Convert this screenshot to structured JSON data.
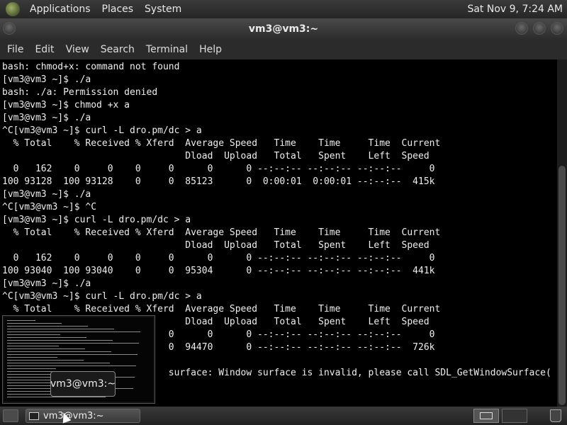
{
  "top_panel": {
    "menus": [
      "Applications",
      "Places",
      "System"
    ],
    "clock": "Sat Nov 9, 7:24 AM"
  },
  "window": {
    "title": "vm3@vm3:~",
    "menu": [
      "File",
      "Edit",
      "View",
      "Search",
      "Terminal",
      "Help"
    ]
  },
  "terminal": {
    "lines": [
      "bash: chmod+x: command not found",
      "[vm3@vm3 ~]$ ./a",
      "bash: ./a: Permission denied",
      "[vm3@vm3 ~]$ chmod +x a",
      "[vm3@vm3 ~]$ ./a",
      "^C[vm3@vm3 ~]$ curl -L dro.pm/dc > a",
      "  % Total    % Received % Xferd  Average Speed   Time    Time     Time  Current",
      "                                 Dload  Upload   Total   Spent    Left  Speed",
      "  0   162    0     0    0     0      0      0 --:--:-- --:--:-- --:--:--     0",
      "100 93128  100 93128    0     0  85123      0  0:00:01  0:00:01 --:--:--  415k",
      "[vm3@vm3 ~]$ ./a",
      "^C[vm3@vm3 ~]$ ^C",
      "[vm3@vm3 ~]$ curl -L dro.pm/dc > a",
      "  % Total    % Received % Xferd  Average Speed   Time    Time     Time  Current",
      "                                 Dload  Upload   Total   Spent    Left  Speed",
      "  0   162    0     0    0     0      0      0 --:--:-- --:--:-- --:--:--     0",
      "100 93040  100 93040    0     0  95304      0 --:--:-- --:--:-- --:--:--  441k",
      "[vm3@vm3 ~]$ ./a",
      "^C[vm3@vm3 ~]$ curl -L dro.pm/dc > a",
      "  % Total    % Received % Xferd  Average Speed   Time    Time     Time  Current",
      "                                 Dload  Upload   Total   Spent    Left  Speed",
      "                              0      0      0 --:--:-- --:--:-- --:--:--     0",
      "10                            0  94470      0 --:--:-- --:--:-- --:--:--  726k",
      "[v",
      "Fa                            surface: Window surface is invalid, please call SDL_GetWindowSurface(",
      ")",
      "[v"
    ]
  },
  "preview": {
    "label": "vm3@vm3:~"
  },
  "taskbar": {
    "task_label": "vm3@vm3:~"
  }
}
